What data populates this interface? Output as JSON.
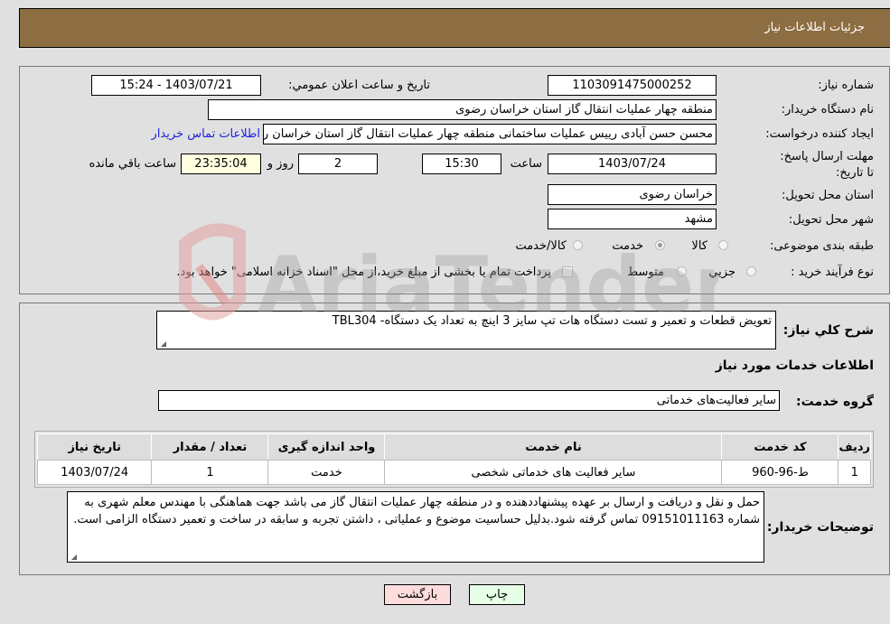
{
  "header": {
    "title": "جزئیات اطلاعات نیاز"
  },
  "form": {
    "need_number": {
      "label": "شماره نیاز:",
      "value": "1103091475000252"
    },
    "announce_datetime": {
      "label": "تاریخ و ساعت اعلان عمومي:",
      "value": "1403/07/21 - 15:24"
    },
    "buyer_org": {
      "label": "نام دستگاه خريدار:",
      "value": "منطقه چهار عملیات انتقال گاز   استان خراسان رضوی"
    },
    "requester": {
      "label": "ایجاد کننده درخواست:",
      "value": "محسن حسن آبادی رییس عملیات ساختمانی منطقه چهار عملیات انتقال گاز   استان خراسان رضوی"
    },
    "buyer_contact_link": "اطلاعات تماس خریدار",
    "deadline": {
      "label": "مهلت ارسال پاسخ: تا تاریخ:",
      "date": "1403/07/24",
      "time_label": "ساعت",
      "time": "15:30",
      "days": "2",
      "days_label": "روز و",
      "remaining": "23:35:04",
      "remaining_label": "ساعت باقي مانده"
    },
    "delivery_province": {
      "label": "استان محل تحویل:",
      "value": "خراسان رضوی"
    },
    "delivery_city": {
      "label": "شهر محل تحویل:",
      "value": "مشهد"
    },
    "category": {
      "label": "طبقه بندی موضوعی:",
      "options": [
        {
          "label": "کالا",
          "checked": false
        },
        {
          "label": "خدمت",
          "checked": true
        },
        {
          "label": "کالا/خدمت",
          "checked": false
        }
      ]
    },
    "purchase_type": {
      "label": "نوع فرآیند خرید :",
      "options": [
        {
          "label": "جزيي",
          "checked": false
        },
        {
          "label": "متوسط",
          "checked": false
        }
      ],
      "treasury_checkbox_label": "پرداخت تمام یا بخشی از مبلغ خرید،از محل \"اسناد خزانه اسلامی\" خواهد بود.",
      "treasury_checked": false
    }
  },
  "description": {
    "label": "شرح كلي نياز:",
    "value": "تعویض قطعات و تعمیر و تست دستگاه هات تپ سایز 3 اینچ به تعداد  یک دستگاه- TBL304"
  },
  "services": {
    "section_title": "اطلاعات خدمات مورد نياز",
    "group_label": "گروه خدمت:",
    "group_value": "سایر فعالیت‌های خدماتی",
    "table": {
      "headers": [
        "رديف",
        "كد خدمت",
        "نام خدمت",
        "واحد اندازه گيری",
        "تعداد / مقدار",
        "تاريخ نياز"
      ],
      "rows": [
        [
          "1",
          "ط-96-960",
          "سایر فعالیت های خدماتی شخصی",
          "خدمت",
          "1",
          "1403/07/24"
        ]
      ]
    }
  },
  "buyer_notes": {
    "label": "توضيحات خريدار:",
    "value": "حمل و نقل و دریافت و ارسال بر عهده پیشنهاددهنده و در منطقه چهار عملیات انتقال گاز می باشد جهت هماهنگی با مهندس معلم شهری به شماره 09151011163 تماس گرفته شود.بدلیل حساسیت موضوع و عملیاتی ، داشتن تجربه و سابقه در ساخت و تعمیر دستگاه الزامی است."
  },
  "buttons": {
    "print": "چاپ",
    "back": "بازگشت"
  },
  "watermark": {
    "text": "AriaTender.neT"
  }
}
